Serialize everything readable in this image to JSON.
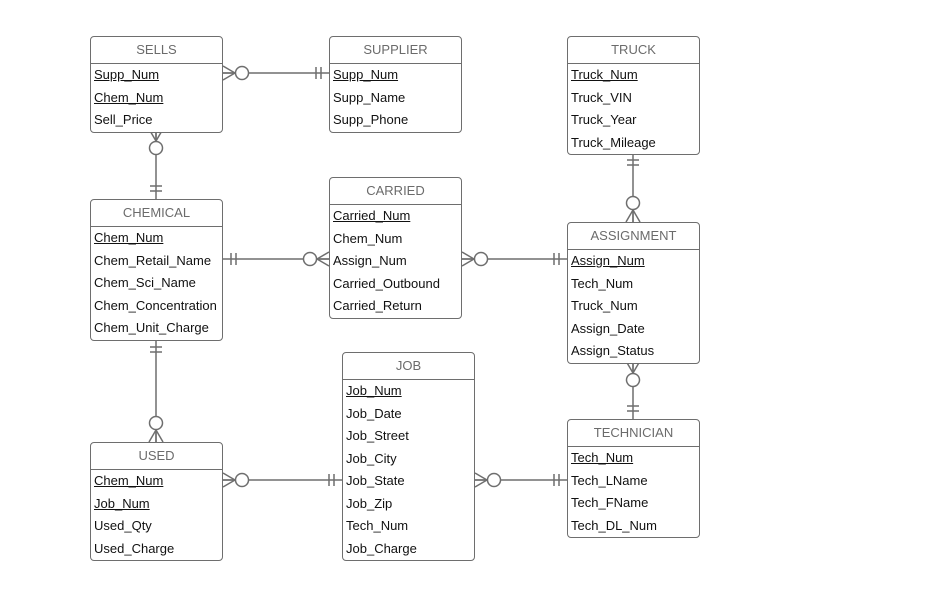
{
  "entities": {
    "sells": {
      "title": "SELLS",
      "attrs": [
        {
          "name": "Supp_Num",
          "key": true
        },
        {
          "name": "Chem_Num",
          "key": true
        },
        {
          "name": "Sell_Price",
          "key": false
        }
      ]
    },
    "supplier": {
      "title": "SUPPLIER",
      "attrs": [
        {
          "name": "Supp_Num",
          "key": true
        },
        {
          "name": "Supp_Name",
          "key": false
        },
        {
          "name": "Supp_Phone",
          "key": false
        }
      ]
    },
    "truck": {
      "title": "TRUCK",
      "attrs": [
        {
          "name": "Truck_Num",
          "key": true
        },
        {
          "name": "Truck_VIN",
          "key": false
        },
        {
          "name": "Truck_Year",
          "key": false
        },
        {
          "name": "Truck_Mileage",
          "key": false
        }
      ]
    },
    "chemical": {
      "title": "CHEMICAL",
      "attrs": [
        {
          "name": "Chem_Num",
          "key": true
        },
        {
          "name": "Chem_Retail_Name",
          "key": false
        },
        {
          "name": "Chem_Sci_Name",
          "key": false
        },
        {
          "name": "Chem_Concentration",
          "key": false
        },
        {
          "name": "Chem_Unit_Charge",
          "key": false
        }
      ]
    },
    "carried": {
      "title": "CARRIED",
      "attrs": [
        {
          "name": "Carried_Num",
          "key": true
        },
        {
          "name": "Chem_Num",
          "key": false
        },
        {
          "name": "Assign_Num",
          "key": false
        },
        {
          "name": "Carried_Outbound",
          "key": false
        },
        {
          "name": "Carried_Return",
          "key": false
        }
      ]
    },
    "assignment": {
      "title": "ASSIGNMENT",
      "attrs": [
        {
          "name": "Assign_Num",
          "key": true
        },
        {
          "name": "Tech_Num",
          "key": false
        },
        {
          "name": "Truck_Num",
          "key": false
        },
        {
          "name": "Assign_Date",
          "key": false
        },
        {
          "name": "Assign_Status",
          "key": false
        }
      ]
    },
    "used": {
      "title": "USED",
      "attrs": [
        {
          "name": "Chem_Num",
          "key": true
        },
        {
          "name": "Job_Num",
          "key": true
        },
        {
          "name": "Used_Qty",
          "key": false
        },
        {
          "name": "Used_Charge",
          "key": false
        }
      ]
    },
    "job": {
      "title": "JOB",
      "attrs": [
        {
          "name": "Job_Num",
          "key": true
        },
        {
          "name": "Job_Date",
          "key": false
        },
        {
          "name": "Job_Street",
          "key": false
        },
        {
          "name": "Job_City",
          "key": false
        },
        {
          "name": "Job_State",
          "key": false
        },
        {
          "name": "Job_Zip",
          "key": false
        },
        {
          "name": "Tech_Num",
          "key": false
        },
        {
          "name": "Job_Charge",
          "key": false
        }
      ]
    },
    "technician": {
      "title": "TECHNICIAN",
      "attrs": [
        {
          "name": "Tech_Num",
          "key": true
        },
        {
          "name": "Tech_LName",
          "key": false
        },
        {
          "name": "Tech_FName",
          "key": false
        },
        {
          "name": "Tech_DL_Num",
          "key": false
        }
      ]
    }
  },
  "relationships": [
    {
      "from": "sells",
      "to": "supplier",
      "from_card": "zero-or-many",
      "to_card": "one-and-only-one"
    },
    {
      "from": "sells",
      "to": "chemical",
      "from_card": "zero-or-many",
      "to_card": "one-and-only-one"
    },
    {
      "from": "chemical",
      "to": "carried",
      "from_card": "one-and-only-one",
      "to_card": "zero-or-many"
    },
    {
      "from": "carried",
      "to": "assignment",
      "from_card": "zero-or-many",
      "to_card": "one-and-only-one"
    },
    {
      "from": "truck",
      "to": "assignment",
      "from_card": "one-and-only-one",
      "to_card": "zero-or-many"
    },
    {
      "from": "assignment",
      "to": "technician",
      "from_card": "zero-or-many",
      "to_card": "one-and-only-one"
    },
    {
      "from": "chemical",
      "to": "used",
      "from_card": "one-and-only-one",
      "to_card": "zero-or-many"
    },
    {
      "from": "used",
      "to": "job",
      "from_card": "zero-or-many",
      "to_card": "one-and-only-one"
    },
    {
      "from": "job",
      "to": "technician",
      "from_card": "zero-or-many",
      "to_card": "one-and-only-one"
    }
  ]
}
